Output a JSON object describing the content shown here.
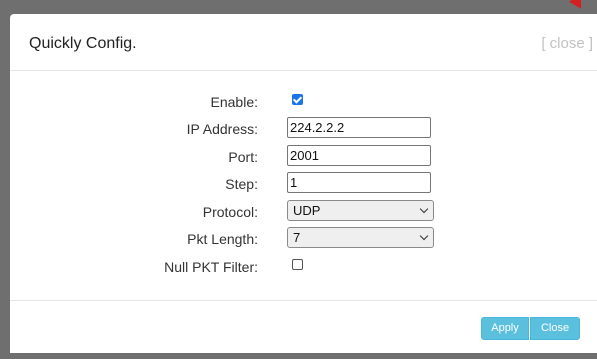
{
  "dialog": {
    "title": "Quickly Config.",
    "close_link": "[ close ]"
  },
  "form": {
    "enable_label": "Enable:",
    "enable_checked": true,
    "ip_label": "IP Address:",
    "ip_value": "224.2.2.2",
    "port_label": "Port:",
    "port_value": "2001",
    "step_label": "Step:",
    "step_value": "1",
    "protocol_label": "Protocol:",
    "protocol_value": "UDP",
    "pkt_length_label": "Pkt Length:",
    "pkt_length_value": "7",
    "null_filter_label": "Null PKT Filter:",
    "null_filter_checked": false
  },
  "footer": {
    "apply_label": "Apply",
    "close_label": "Close"
  },
  "colors": {
    "button": "#5bc0de",
    "checkbox": "#1a73e8",
    "backdrop": "#6f6f6f"
  }
}
